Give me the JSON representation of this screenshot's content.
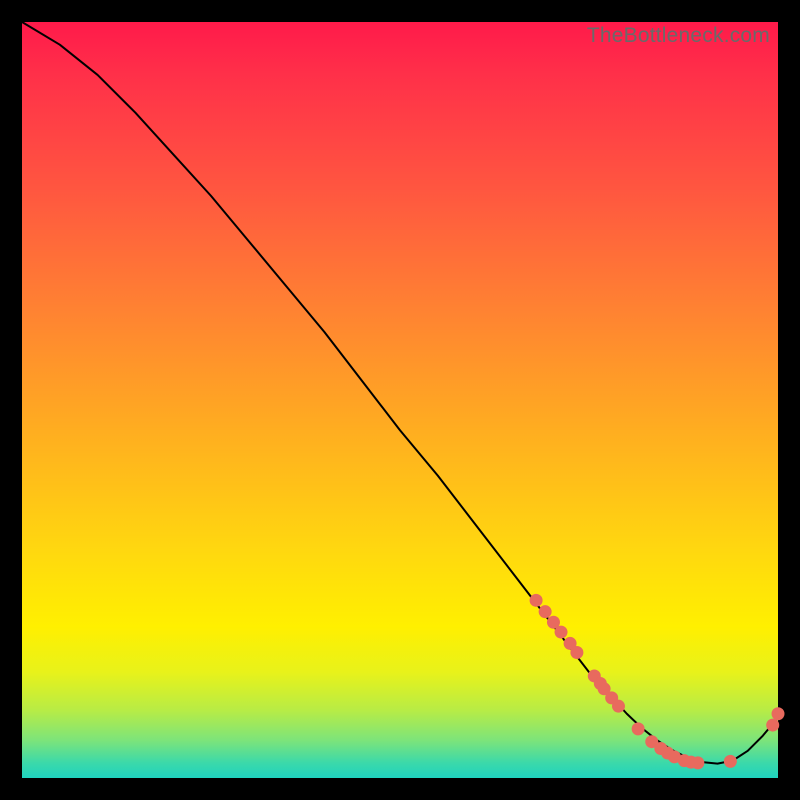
{
  "watermark": "TheBottleneck.com",
  "colors": {
    "dot": "#e86a5e",
    "curve": "#000000",
    "bg_black": "#000000"
  },
  "chart_data": {
    "type": "line",
    "title": "",
    "xlabel": "",
    "ylabel": "",
    "xlim": [
      0,
      100
    ],
    "ylim": [
      0,
      100
    ],
    "grid": false,
    "legend": false,
    "series": [
      {
        "name": "bottleneck-curve",
        "x": [
          0,
          5,
          10,
          15,
          20,
          25,
          30,
          35,
          40,
          45,
          50,
          55,
          60,
          65,
          70,
          75,
          80,
          82,
          84,
          86,
          88,
          90,
          92,
          94,
          96,
          98,
          100
        ],
        "y": [
          100,
          97,
          93,
          88,
          82.5,
          77,
          71,
          65,
          59,
          52.5,
          46,
          40,
          33.5,
          27,
          20.5,
          14,
          8.5,
          6.6,
          5,
          3.7,
          2.7,
          2.1,
          1.9,
          2.3,
          3.6,
          5.6,
          8
        ]
      }
    ],
    "scatter": [
      {
        "name": "curve-markers",
        "points": [
          {
            "x": 68.0,
            "y": 23.5
          },
          {
            "x": 69.2,
            "y": 22.0
          },
          {
            "x": 70.3,
            "y": 20.6
          },
          {
            "x": 71.3,
            "y": 19.3
          },
          {
            "x": 72.5,
            "y": 17.8
          },
          {
            "x": 73.4,
            "y": 16.6
          },
          {
            "x": 75.7,
            "y": 13.5
          },
          {
            "x": 76.5,
            "y": 12.5
          },
          {
            "x": 77.0,
            "y": 11.8
          },
          {
            "x": 78.0,
            "y": 10.6
          },
          {
            "x": 78.9,
            "y": 9.5
          },
          {
            "x": 81.5,
            "y": 6.5
          },
          {
            "x": 83.3,
            "y": 4.8
          },
          {
            "x": 84.5,
            "y": 3.9
          },
          {
            "x": 85.4,
            "y": 3.3
          },
          {
            "x": 86.3,
            "y": 2.8
          },
          {
            "x": 87.6,
            "y": 2.3
          },
          {
            "x": 88.5,
            "y": 2.1
          },
          {
            "x": 89.4,
            "y": 2.0
          },
          {
            "x": 93.7,
            "y": 2.2
          },
          {
            "x": 99.3,
            "y": 7.0
          },
          {
            "x": 100.0,
            "y": 8.5
          }
        ]
      }
    ]
  }
}
